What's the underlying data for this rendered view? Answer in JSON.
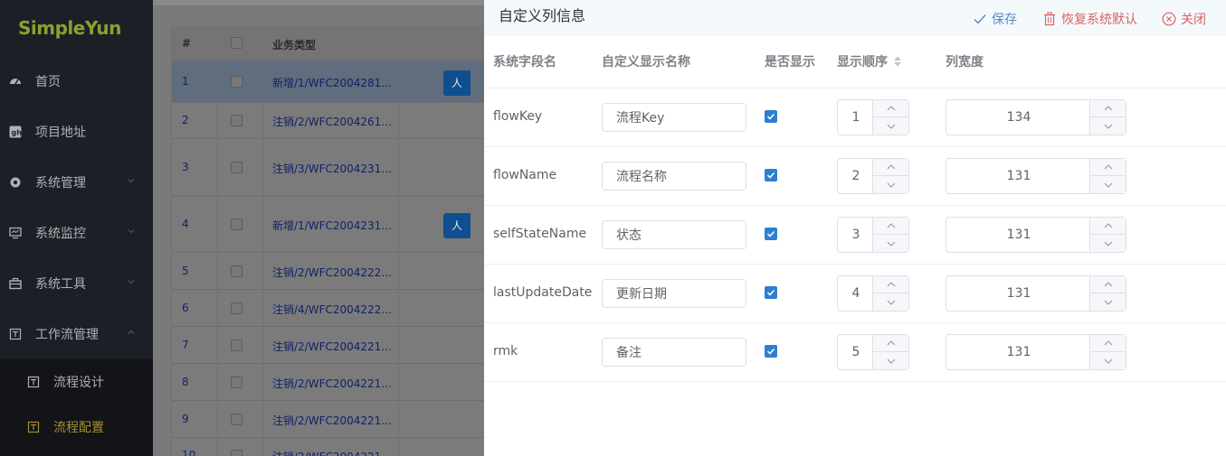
{
  "sidebar": {
    "logo": "SimpleYun",
    "menu": [
      {
        "label": "首页",
        "icon": "dashboard-icon",
        "has_submenu": false
      },
      {
        "label": "项目地址",
        "icon": "github-icon",
        "has_submenu": false
      },
      {
        "label": "系统管理",
        "icon": "gear-icon",
        "has_submenu": true
      },
      {
        "label": "系统监控",
        "icon": "monitor-icon",
        "has_submenu": true
      },
      {
        "label": "系统工具",
        "icon": "toolbox-icon",
        "has_submenu": true
      },
      {
        "label": "工作流管理",
        "icon": "workflow-icon",
        "has_submenu": true,
        "expanded": true
      }
    ],
    "submenu": [
      {
        "label": "流程设计",
        "icon": "workflow-icon",
        "active": false
      },
      {
        "label": "流程配置",
        "icon": "workflow-icon",
        "active": true
      }
    ],
    "active_color": "#a8902a"
  },
  "background_table": {
    "headers": {
      "num": "#",
      "biz_type": "业务类型"
    },
    "rows": [
      {
        "num": "1",
        "biz": "新增/1/WFC2004281…",
        "highlighted": true,
        "button": "人"
      },
      {
        "num": "2",
        "biz": "注销/2/WFC2004261…"
      },
      {
        "num": "3",
        "biz": "注销/3/WFC2004231…"
      },
      {
        "num": "4",
        "biz": "新增/1/WFC2004231…",
        "button": "人"
      },
      {
        "num": "5",
        "biz": "注销/2/WFC2004222…"
      },
      {
        "num": "6",
        "biz": "注销/4/WFC2004222…"
      },
      {
        "num": "7",
        "biz": "注销/2/WFC2004221…"
      },
      {
        "num": "8",
        "biz": "注销/2/WFC2004221…"
      },
      {
        "num": "9",
        "biz": "注销/2/WFC2004221…"
      },
      {
        "num": "10",
        "biz": "注销/2/WFC2004221…"
      }
    ]
  },
  "drawer": {
    "title": "自定义列信息",
    "actions": {
      "save": "保存",
      "reset": "恢复系统默认",
      "close": "关闭"
    },
    "columns": {
      "field": "系统字段名",
      "display_name": "自定义显示名称",
      "visible": "是否显示",
      "order": "显示顺序",
      "width": "列宽度"
    },
    "rows": [
      {
        "field": "flowKey",
        "display_name": "流程Key",
        "visible": true,
        "order": "1",
        "width": "134"
      },
      {
        "field": "flowName",
        "display_name": "流程名称",
        "visible": true,
        "order": "2",
        "width": "131"
      },
      {
        "field": "selfStateName",
        "display_name": "状态",
        "visible": true,
        "order": "3",
        "width": "131"
      },
      {
        "field": "lastUpdateDate",
        "display_name": "更新日期",
        "visible": true,
        "order": "4",
        "width": "131"
      },
      {
        "field": "rmk",
        "display_name": "备注",
        "visible": true,
        "order": "5",
        "width": "131"
      }
    ],
    "colors": {
      "primary": "#2d7fd1",
      "danger": "#dd6262",
      "save": "#5b86c4"
    }
  }
}
